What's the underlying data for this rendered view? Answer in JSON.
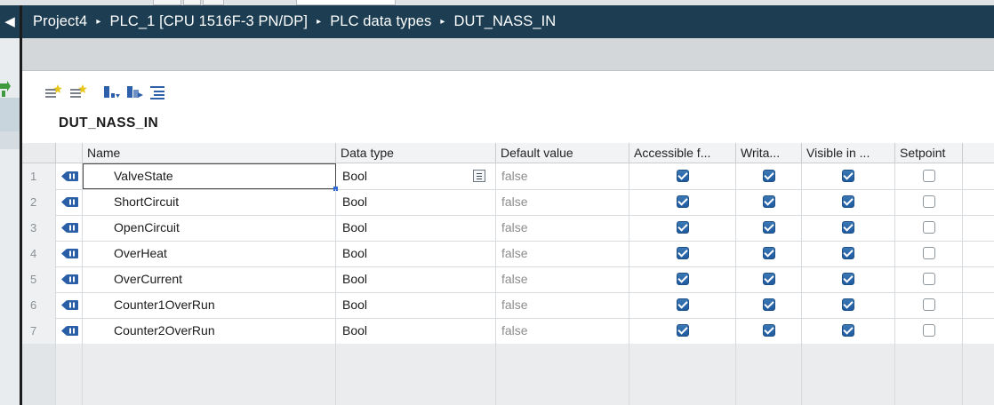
{
  "breadcrumb": {
    "items": [
      "Project4",
      "PLC_1 [CPU 1516F-3 PN/DP]",
      "PLC data types",
      "DUT_NASS_IN"
    ],
    "separator": "▸"
  },
  "left_toggle": "◀",
  "toolbar": {
    "icons": [
      "insert-row-icon",
      "add-row-icon",
      "expand-icon",
      "collapse-icon",
      "overview-icon"
    ]
  },
  "datatype_title": "DUT_NASS_IN",
  "table": {
    "headers": [
      "Name",
      "Data type",
      "Default value",
      "Accessible f...",
      "Writa...",
      "Visible in ...",
      "Setpoint"
    ],
    "rows": [
      {
        "num": "1",
        "name": "ValveState",
        "type": "Bool",
        "default": "false",
        "accessible": true,
        "writable": true,
        "visible": true,
        "setpoint": false
      },
      {
        "num": "2",
        "name": "ShortCircuit",
        "type": "Bool",
        "default": "false",
        "accessible": true,
        "writable": true,
        "visible": true,
        "setpoint": false
      },
      {
        "num": "3",
        "name": "OpenCircuit",
        "type": "Bool",
        "default": "false",
        "accessible": true,
        "writable": true,
        "visible": true,
        "setpoint": false
      },
      {
        "num": "4",
        "name": "OverHeat",
        "type": "Bool",
        "default": "false",
        "accessible": true,
        "writable": true,
        "visible": true,
        "setpoint": false
      },
      {
        "num": "5",
        "name": "OverCurrent",
        "type": "Bool",
        "default": "false",
        "accessible": true,
        "writable": true,
        "visible": true,
        "setpoint": false
      },
      {
        "num": "6",
        "name": "Counter1OverRun",
        "type": "Bool",
        "default": "false",
        "accessible": true,
        "writable": true,
        "visible": true,
        "setpoint": false
      },
      {
        "num": "7",
        "name": "Counter2OverRun",
        "type": "Bool",
        "default": "false",
        "accessible": true,
        "writable": true,
        "visible": true,
        "setpoint": false
      }
    ],
    "selected_row": 0
  },
  "colors": {
    "header_bar": "#1c3d52",
    "checkbox_on": "#2a67a8",
    "member_icon": "#2a5fa8"
  }
}
